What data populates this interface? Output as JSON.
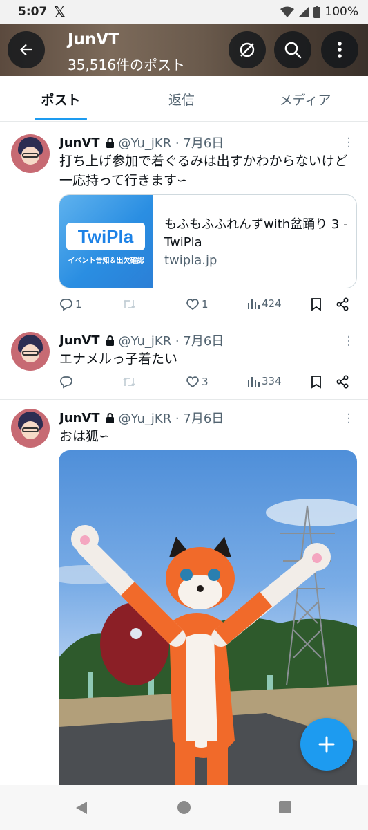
{
  "status_bar": {
    "time": "5:07",
    "app_glyph": "𝕏",
    "battery": "100%"
  },
  "header": {
    "name": "JunVT",
    "post_count": "35,516件のポスト",
    "icons": [
      "back-arrow-icon",
      "no-notification-icon",
      "search-icon",
      "more-vertical-icon"
    ]
  },
  "tabs": [
    {
      "label": "ポスト",
      "active": true
    },
    {
      "label": "返信",
      "active": false
    },
    {
      "label": "メディア",
      "active": false
    }
  ],
  "tweets": [
    {
      "name": "JunVT",
      "handle": "@Yu_jKR · 7月6日",
      "text": "打ち上げ参加で着ぐるみは出すかわからないけど一応持って行きます∽",
      "card": {
        "logo": "TwiPla",
        "logo_sub": "イベント告知＆出欠確認",
        "title": "もふもふふれんずwith盆踊り 3 - TwiPla",
        "domain": "twipla.jp"
      },
      "reply_count": "1",
      "retweet_count": "",
      "like_count": "1",
      "views": "424"
    },
    {
      "name": "JunVT",
      "handle": "@Yu_jKR · 7月6日",
      "text": "エナメルっ子着たい",
      "reply_count": "",
      "retweet_count": "",
      "like_count": "3",
      "views": "334"
    },
    {
      "name": "JunVT",
      "handle": "@Yu_jKR · 7月6日",
      "text": "おは狐∽"
    }
  ],
  "colors": {
    "accent": "#1d9bf0",
    "text": "#0f1419",
    "secondary": "#536471"
  }
}
